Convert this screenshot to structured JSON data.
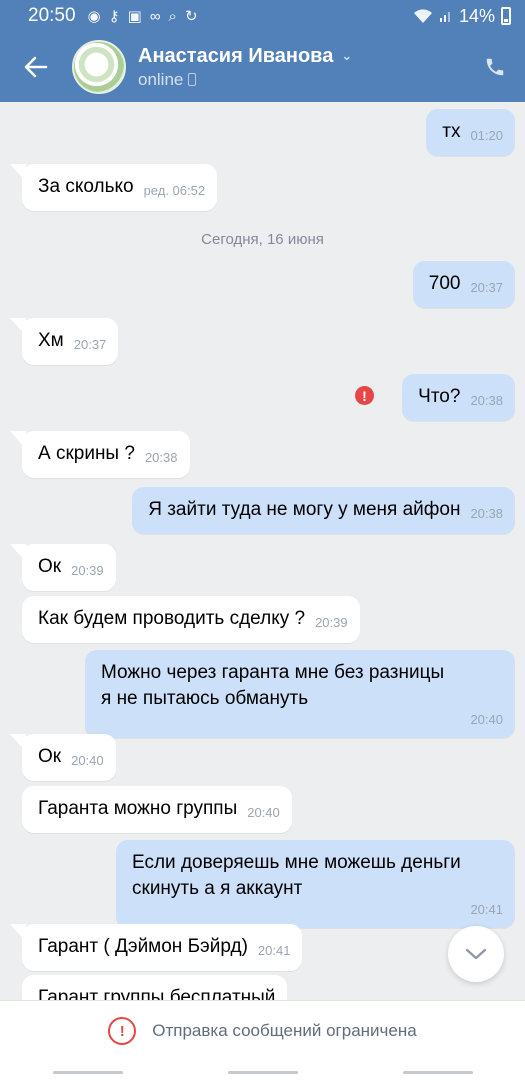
{
  "status_bar": {
    "time": "20:50",
    "battery": "14%",
    "icons": [
      "chrome-icon",
      "key-icon",
      "image-icon",
      "link-icon",
      "search-icon",
      "sync-icon"
    ]
  },
  "header": {
    "name": "Анастасия Иванова",
    "status": "online"
  },
  "date_separator": "Сегодня, 16 июня",
  "messages": [
    {
      "dir": "out",
      "text": "тх",
      "time": "01:20"
    },
    {
      "dir": "in",
      "text": "За сколько",
      "time": "ред. 06:52"
    },
    {
      "dir": "out",
      "text": "700",
      "time": "20:37"
    },
    {
      "dir": "in",
      "text": "Хм",
      "time": "20:37"
    },
    {
      "dir": "out",
      "text": "Что?",
      "time": "20:38",
      "error": true
    },
    {
      "dir": "in",
      "text": "А скрины ?",
      "time": "20:38"
    },
    {
      "dir": "out",
      "text": "Я зайти туда не могу у меня айфон",
      "time": "20:38"
    },
    {
      "dir": "in",
      "text": "Ок",
      "time": "20:39"
    },
    {
      "dir": "in",
      "text": "Как будем проводить сделку ?",
      "time": "20:39"
    },
    {
      "dir": "out",
      "text": "Можно через гаранта мне без разницы\nя не пытаюсь обмануть",
      "time": "20:40"
    },
    {
      "dir": "in",
      "text": "Ок",
      "time": "20:40"
    },
    {
      "dir": "in",
      "text": "Гаранта можно группы",
      "time": "20:40"
    },
    {
      "dir": "out",
      "text": "Если доверяешь мне можешь деньги\nскинуть а я аккаунт",
      "time": "20:41"
    },
    {
      "dir": "in",
      "text": "Гарант ( Дэймон Бэйрд)",
      "time": "20:41"
    },
    {
      "dir": "in",
      "text": "Гарант группы бесплатный",
      "time": ""
    }
  ],
  "footer": {
    "restriction": "Отправка сообщений ограничена"
  },
  "colors": {
    "accent": "#5181b8",
    "bubble_out": "#cce0fa",
    "bubble_in": "#ffffff",
    "background": "#edeef0",
    "error": "#e64646"
  }
}
